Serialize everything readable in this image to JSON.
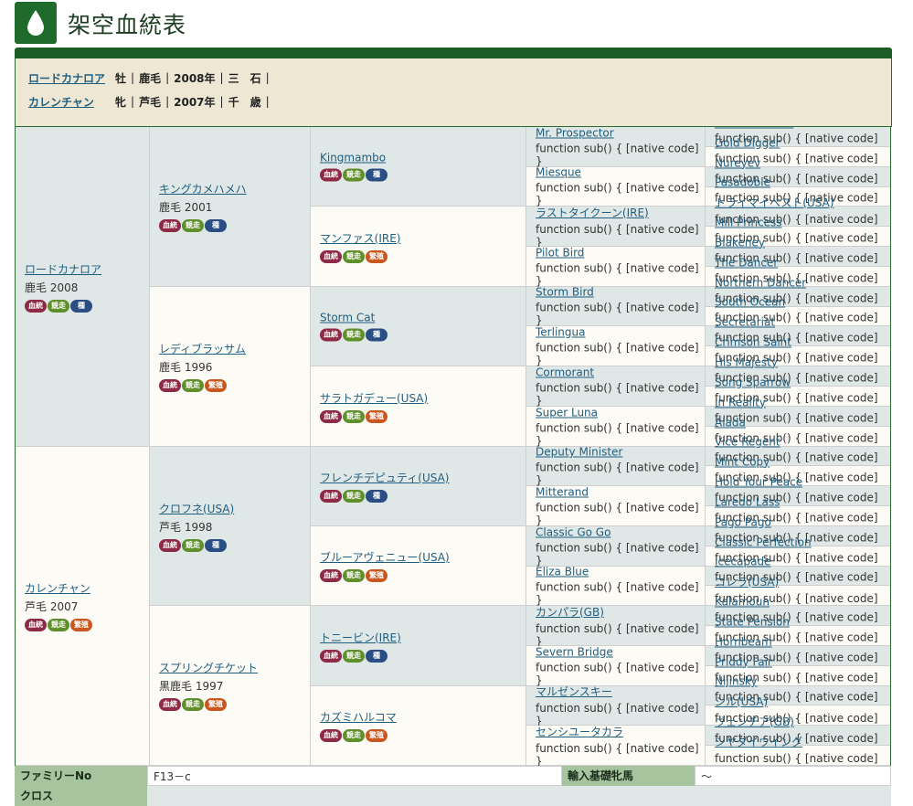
{
  "page": {
    "title": "架空血統表",
    "logo_icon": "drop-icon"
  },
  "parents": [
    {
      "name": "ロードカナロア",
      "sex": "牡",
      "color": "鹿毛",
      "year": "2008年",
      "location": "三　石"
    },
    {
      "name": "カレンチャン",
      "sex": "牝",
      "color": "芦毛",
      "year": "2007年",
      "location": "千　歳"
    }
  ],
  "badge_labels": {
    "ketto": "血統",
    "kyoso": "競走",
    "shu": "種",
    "hanshoku": "繁殖"
  },
  "gen1": [
    {
      "name": "ロードカナロア",
      "sub": "鹿毛 2008",
      "badges": [
        "ketto",
        "kyoso",
        "shu"
      ]
    },
    {
      "name": "カレンチャン",
      "sub": "芦毛 2007",
      "badges": [
        "ketto",
        "kyoso",
        "hanshoku"
      ]
    }
  ],
  "gen2": [
    {
      "name": "キングカメハメハ",
      "sub": "鹿毛 2001",
      "badges": [
        "ketto",
        "kyoso",
        "shu"
      ]
    },
    {
      "name": "レディブラッサム",
      "sub": "鹿毛 1996",
      "badges": [
        "ketto",
        "kyoso",
        "hanshoku"
      ]
    },
    {
      "name": "クロフネ(USA)",
      "sub": "芦毛 1998",
      "badges": [
        "ketto",
        "kyoso",
        "shu"
      ]
    },
    {
      "name": "スプリングチケット",
      "sub": "黒鹿毛 1997",
      "badges": [
        "ketto",
        "kyoso",
        "hanshoku"
      ]
    }
  ],
  "gen3": [
    {
      "name": "Kingmambo",
      "badges": [
        "ketto",
        "kyoso",
        "shu"
      ]
    },
    {
      "name": "マンファス(IRE)",
      "badges": [
        "ketto",
        "kyoso",
        "hanshoku"
      ]
    },
    {
      "name": "Storm Cat",
      "badges": [
        "ketto",
        "kyoso",
        "shu"
      ]
    },
    {
      "name": "サラトガデュー(USA)",
      "badges": [
        "ketto",
        "kyoso",
        "hanshoku"
      ]
    },
    {
      "name": "フレンチデピュティ(USA)",
      "badges": [
        "ketto",
        "kyoso",
        "shu"
      ]
    },
    {
      "name": "ブルーアヴェニュー(USA)",
      "badges": [
        "ketto",
        "kyoso",
        "hanshoku"
      ]
    },
    {
      "name": "トニービン(IRE)",
      "badges": [
        "ketto",
        "kyoso",
        "shu"
      ]
    },
    {
      "name": "カズミハルコマ",
      "badges": [
        "ketto",
        "kyoso",
        "hanshoku"
      ]
    }
  ],
  "gen4": [
    "Mr. Prospector",
    "Miesque",
    "ラストタイクーン(IRE)",
    "Pilot Bird",
    "Storm Bird",
    "Terlingua",
    "Cormorant",
    "Super Luna",
    "Deputy Minister",
    "Mitterand",
    "Classic Go Go",
    "Eliza Blue",
    "カンパラ(GB)",
    "Severn Bridge",
    "マルゼンスキー",
    "センシユータカラ"
  ],
  "gen5": [
    "Raise a Native",
    "Gold Digger",
    "Nureyev",
    "Pasadoble",
    "トライマイベスト(USA)",
    "Mill Princess",
    "Blakeney",
    "The Dancer",
    "Northern Dancer",
    "South Ocean",
    "Secretariat",
    "Crimson Saint",
    "His Majesty",
    "Song Sparrow",
    "In Reality",
    "Alada",
    "Vice Regent",
    "Mint Copy",
    "Hold Your Peace",
    "Laredo Lass",
    "Pago Pago",
    "Classic Perfection",
    "Icecapade",
    "コレラ(USA)",
    "Kalamoun",
    "State Pension",
    "Hornbeam",
    "Priddy Fair",
    "Nijinsky",
    "シル(USA)",
    "ヴェンチア(GB)",
    "シヤダイウイング"
  ],
  "footer": {
    "family_label": "ファミリーNo",
    "family_value": "F13－c",
    "import_label": "輸入基礎牝馬",
    "import_value": "～",
    "cross_label": "クロス",
    "cross_value": ""
  },
  "colors": {
    "brand_green": "#1e6b2b",
    "info_bg": "#ede7d3",
    "row_green": "#dfe8e6",
    "row_cream": "#fdfbf6"
  }
}
